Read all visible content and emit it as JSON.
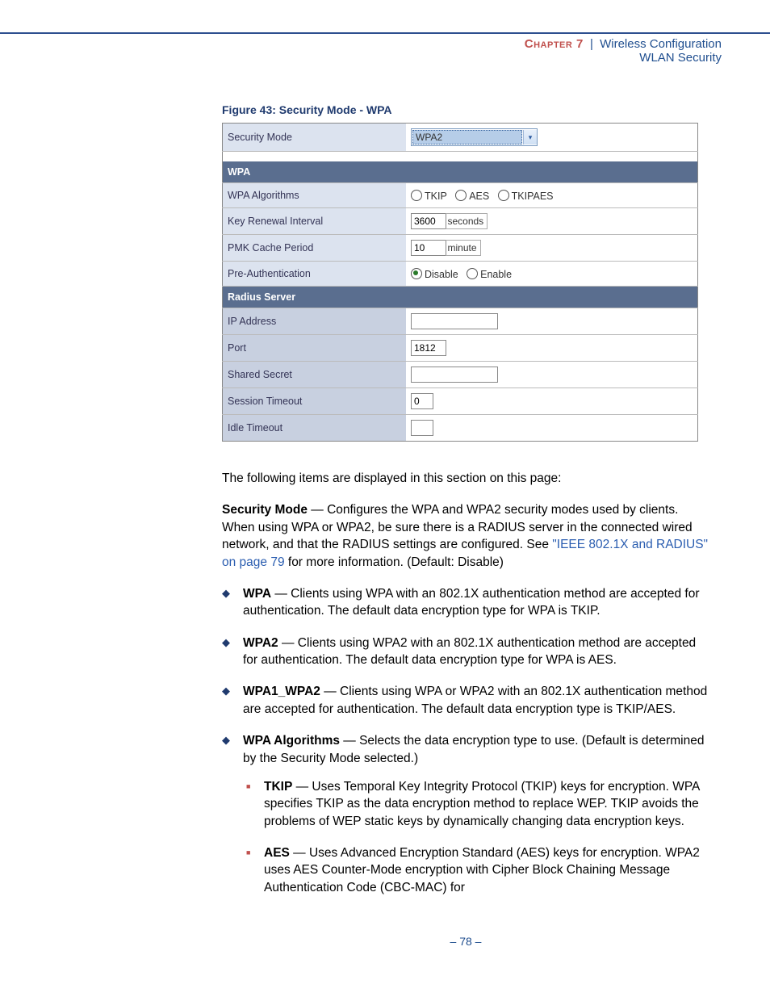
{
  "header": {
    "chapter_label": "Chapter 7",
    "separator": "|",
    "chapter_title": "Wireless Configuration",
    "subtitle": "WLAN Security"
  },
  "figure": {
    "caption": "Figure 43:  Security Mode - WPA",
    "security_mode_label": "Security Mode",
    "security_mode_value": "WPA2",
    "wpa_section": "WPA",
    "wpa_algorithms_label": "WPA Algorithms",
    "opt_tkip": "TKIP",
    "opt_aes": "AES",
    "opt_tkipaes": "TKIPAES",
    "key_renewal_label": "Key Renewal Interval",
    "key_renewal_value": "3600",
    "key_renewal_unit": "seconds",
    "pmk_label": "PMK Cache Period",
    "pmk_value": "10",
    "pmk_unit": "minute",
    "preauth_label": "Pre-Authentication",
    "preauth_disable": "Disable",
    "preauth_enable": "Enable",
    "radius_section": "Radius Server",
    "ip_label": "IP Address",
    "ip_value": "",
    "port_label": "Port",
    "port_value": "1812",
    "secret_label": "Shared Secret",
    "secret_value": "",
    "session_label": "Session Timeout",
    "session_value": "0",
    "idle_label": "Idle Timeout",
    "idle_value": ""
  },
  "body": {
    "intro": "The following items are displayed in this section on this page:",
    "sec_mode_label": "Security Mode",
    "sec_mode_text_1": " — Configures the WPA and WPA2 security modes used by clients. When using WPA or WPA2, be sure there is a RADIUS server in the connected wired network, and that the RADIUS settings are configured. See ",
    "sec_mode_link": "\"IEEE 802.1X and RADIUS\" on page 79",
    "sec_mode_text_2": " for more information. (Default: Disable)",
    "b1_label": "WPA",
    "b1_text": " — Clients using WPA with an 802.1X authentication method are accepted for authentication. The default data encryption type for WPA is TKIP.",
    "b2_label": "WPA2",
    "b2_text": " — Clients using WPA2 with an 802.1X authentication method are accepted for authentication. The default data encryption type for WPA is AES.",
    "b3_label": "WPA1_WPA2",
    "b3_text": " — Clients using WPA or WPA2 with an 802.1X authentication method are accepted for authentication. The default data encryption type is TKIP/AES.",
    "b4_label": "WPA Algorithms",
    "b4_text": " — Selects the data encryption type to use. (Default is determined by the Security Mode selected.)",
    "s1_label": "TKIP",
    "s1_text": " — Uses Temporal Key Integrity Protocol (TKIP) keys for encryption. WPA specifies TKIP as the data encryption method to replace WEP. TKIP avoids the problems of WEP static keys by dynamically changing data encryption keys.",
    "s2_label": "AES",
    "s2_text": " — Uses Advanced Encryption Standard (AES) keys for encryption. WPA2 uses AES Counter-Mode encryption with Cipher Block Chaining Message Authentication Code (CBC-MAC) for"
  },
  "footer": {
    "page": "–  78  –"
  }
}
